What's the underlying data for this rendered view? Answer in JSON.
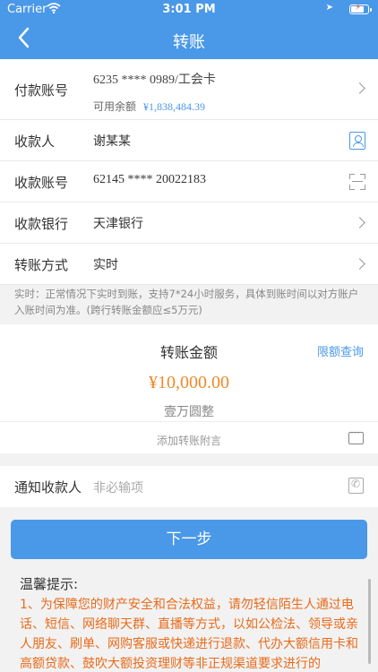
{
  "status_bar": {
    "carrier": "Carrier",
    "time": "3:01 PM"
  },
  "header": {
    "title": "转账",
    "back_icon": "chevron-left-icon"
  },
  "form": {
    "payer_account": {
      "label": "付款账号",
      "value": "6235 **** 0989/工会卡",
      "balance_label": "可用余额",
      "balance_value": "¥1,838,484.39"
    },
    "payee": {
      "label": "收款人",
      "value": "谢某某"
    },
    "payee_account": {
      "label": "收款账号",
      "value": "62145 **** 20022183"
    },
    "payee_bank": {
      "label": "收款银行",
      "value": "天津银行"
    },
    "transfer_method": {
      "label": "转账方式",
      "value": "实时"
    }
  },
  "notice": "实时：正常情况下实时到账，支持7*24小时服务，具体到账时间以对方账户入账时间为准。(跨行转账金额应≤5万元)",
  "amount": {
    "title": "转账金额",
    "limit_link": "限额查询",
    "value": "¥10,000.00",
    "words": "壹万圆整",
    "memo_placeholder": "添加转账附言"
  },
  "notify": {
    "label": "通知收款人",
    "placeholder": "非必输项"
  },
  "next_button": "下一步",
  "tips": {
    "title": "温馨提示:",
    "body": "1、为保障您的财产安全和合法权益，请勿轻信陌生人通过电话、短信、网络聊天群、直播等方式，以如公检法、领导或亲人朋友、刷单、网购客服或快递进行退款、代办大额信用卡和高额贷款、鼓吹大额投资理财等非正规渠道要求进行的"
  },
  "colors": {
    "primary": "#4a98e8",
    "amount": "#ee8a2a",
    "warning": "#e86b1b"
  }
}
